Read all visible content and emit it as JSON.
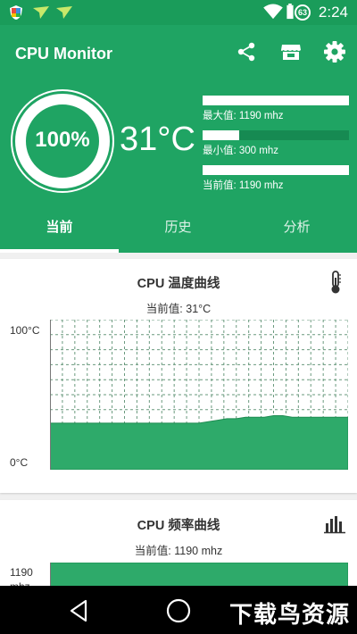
{
  "status_bar": {
    "time": "2:24",
    "battery_level": "63",
    "icons": [
      "shield-notification-icon",
      "paper-plane-notification-icon",
      "paper-plane-notification-icon",
      "wifi-icon",
      "battery-icon"
    ]
  },
  "app": {
    "title": "CPU Monitor",
    "toolbar": [
      "share-icon",
      "store-icon",
      "settings-icon"
    ]
  },
  "summary": {
    "usage_percent": "100%",
    "usage_fraction": 1.0,
    "temperature": "31°C",
    "bars": [
      {
        "label": "最大值: 1190 mhz",
        "fraction": 1.0
      },
      {
        "label": "最小值: 300 mhz",
        "fraction": 0.25
      },
      {
        "label": "当前值: 1190 mhz",
        "fraction": 1.0
      }
    ]
  },
  "tabs": [
    {
      "label": "当前",
      "active": true
    },
    {
      "label": "历史",
      "active": false
    },
    {
      "label": "分析",
      "active": false
    }
  ],
  "temp_card": {
    "title": "CPU 温度曲线",
    "current": "当前值: 31°C",
    "icon": "thermometer-icon",
    "y_max_label": "100°C",
    "y_min_label": "0°C"
  },
  "freq_card": {
    "title": "CPU 频率曲线",
    "current": "当前值: 1190 mhz",
    "icon": "bar-chart-icon",
    "y_max_label": "1190",
    "y_unit_label": "mhz"
  },
  "chart_data": [
    {
      "type": "area",
      "ylim": [
        0,
        100
      ],
      "values": [
        31,
        31,
        31,
        31,
        31,
        31,
        31,
        31,
        31,
        31,
        31,
        31,
        31,
        31,
        31,
        31,
        31,
        32,
        33,
        34,
        34,
        35,
        35,
        35,
        36,
        36,
        35,
        35,
        35,
        35,
        35,
        35,
        35
      ]
    },
    {
      "type": "area",
      "ylim": [
        0,
        1190
      ],
      "values": [
        1190,
        1190,
        1190,
        1190,
        1190,
        1190,
        1190,
        1190
      ]
    }
  ],
  "watermark": "下载鸟资源",
  "colors": {
    "primary": "#1fa463",
    "status": "#1a9c5a",
    "chart_fill": "#2eaa6a"
  }
}
